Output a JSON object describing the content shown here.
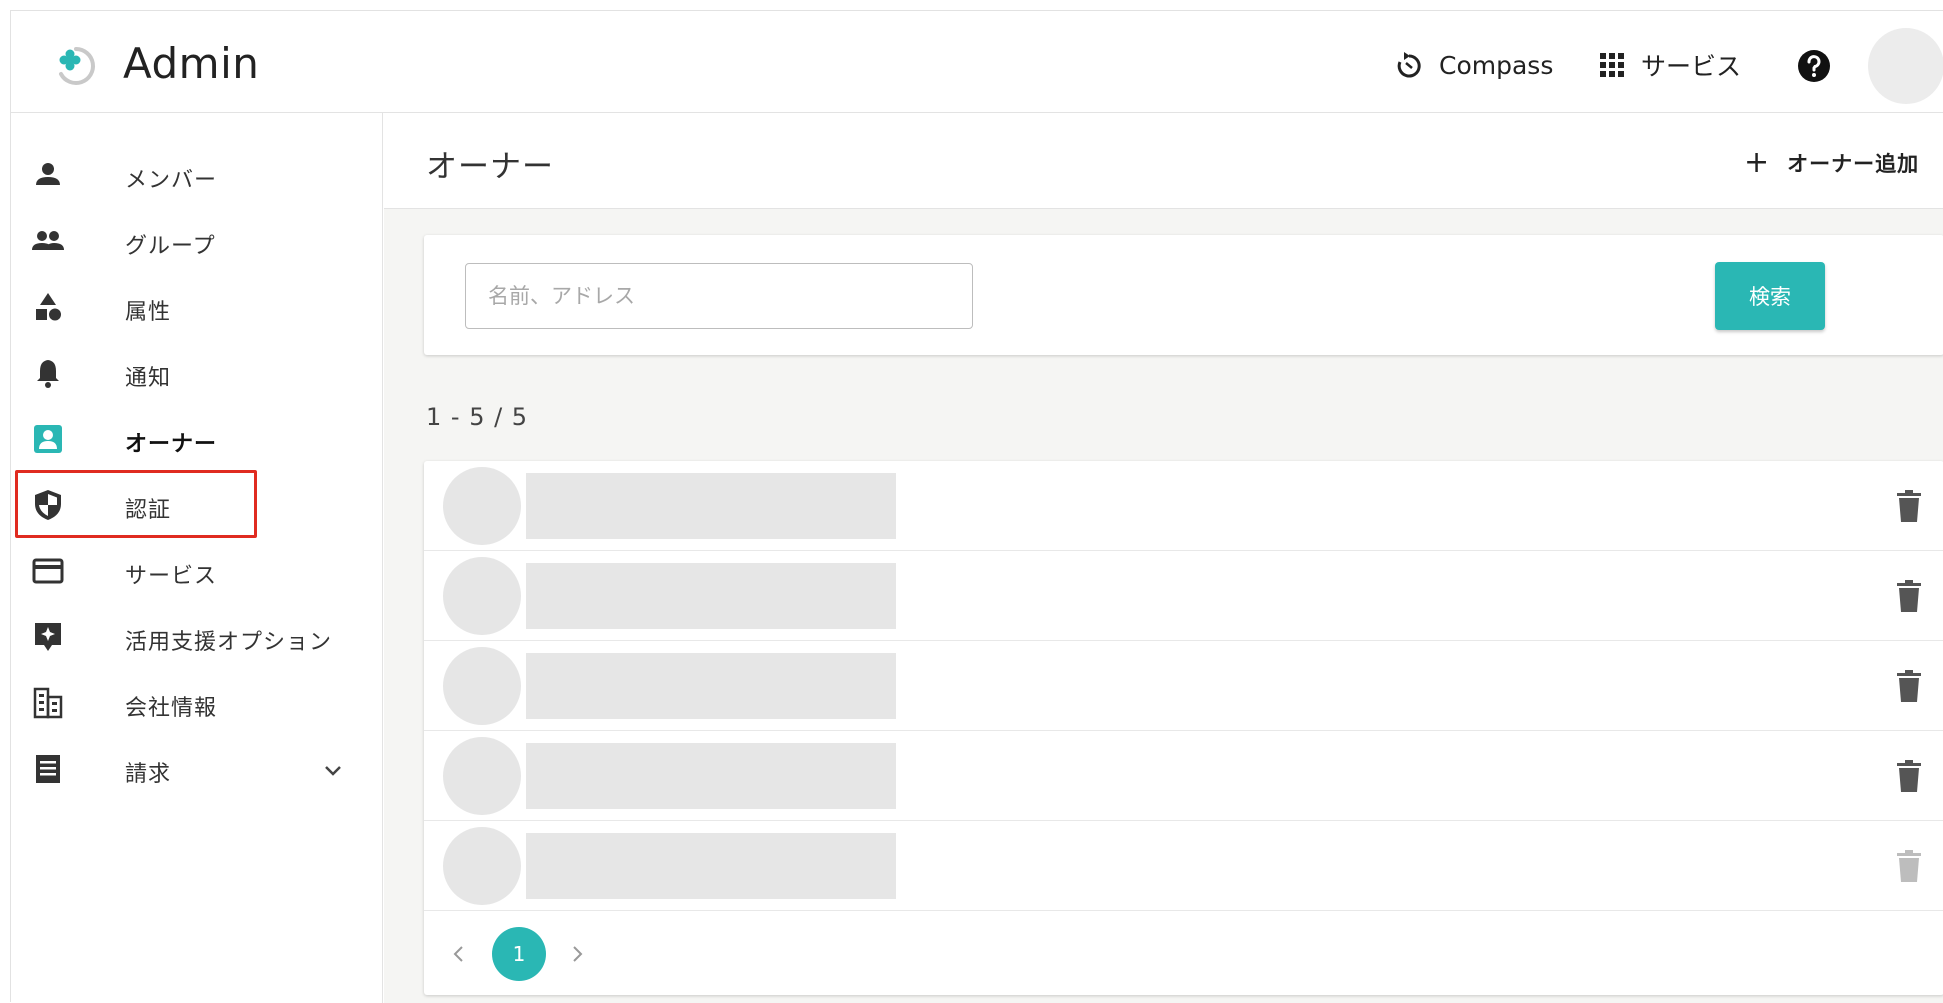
{
  "colors": {
    "accent": "#2ab7b4",
    "highlight": "#e02b20",
    "placeholder_gray": "#e6e6e6"
  },
  "header": {
    "title": "Admin",
    "logo_icon": "flower-ring-logo",
    "compass_label": "Compass",
    "services_label": "サービス",
    "help_icon": "question-circle-icon"
  },
  "sidebar": {
    "items": [
      {
        "label": "メンバー",
        "icon": "person-icon"
      },
      {
        "label": "グループ",
        "icon": "people-icon"
      },
      {
        "label": "属性",
        "icon": "shapes-icon"
      },
      {
        "label": "通知",
        "icon": "bell-icon"
      },
      {
        "label": "オーナー",
        "icon": "account-box-icon",
        "active": true
      },
      {
        "label": "認証",
        "icon": "shield-icon"
      },
      {
        "label": "サービス",
        "icon": "card-icon"
      },
      {
        "label": "活用支援オプション",
        "icon": "sparkle-box-icon"
      },
      {
        "label": "会社情報",
        "icon": "building-icon"
      },
      {
        "label": "請求",
        "icon": "receipt-icon",
        "expandable": true
      }
    ]
  },
  "main": {
    "title": "オーナー",
    "add_label": "オーナー追加",
    "search": {
      "placeholder": "名前、アドレス",
      "value": "",
      "button": "検索"
    },
    "result_count": "1 - 5 / 5",
    "rows": [
      {
        "delete_enabled": true
      },
      {
        "delete_enabled": true
      },
      {
        "delete_enabled": true
      },
      {
        "delete_enabled": true
      },
      {
        "delete_enabled": false
      }
    ],
    "pagination": {
      "current_page": "1"
    }
  }
}
